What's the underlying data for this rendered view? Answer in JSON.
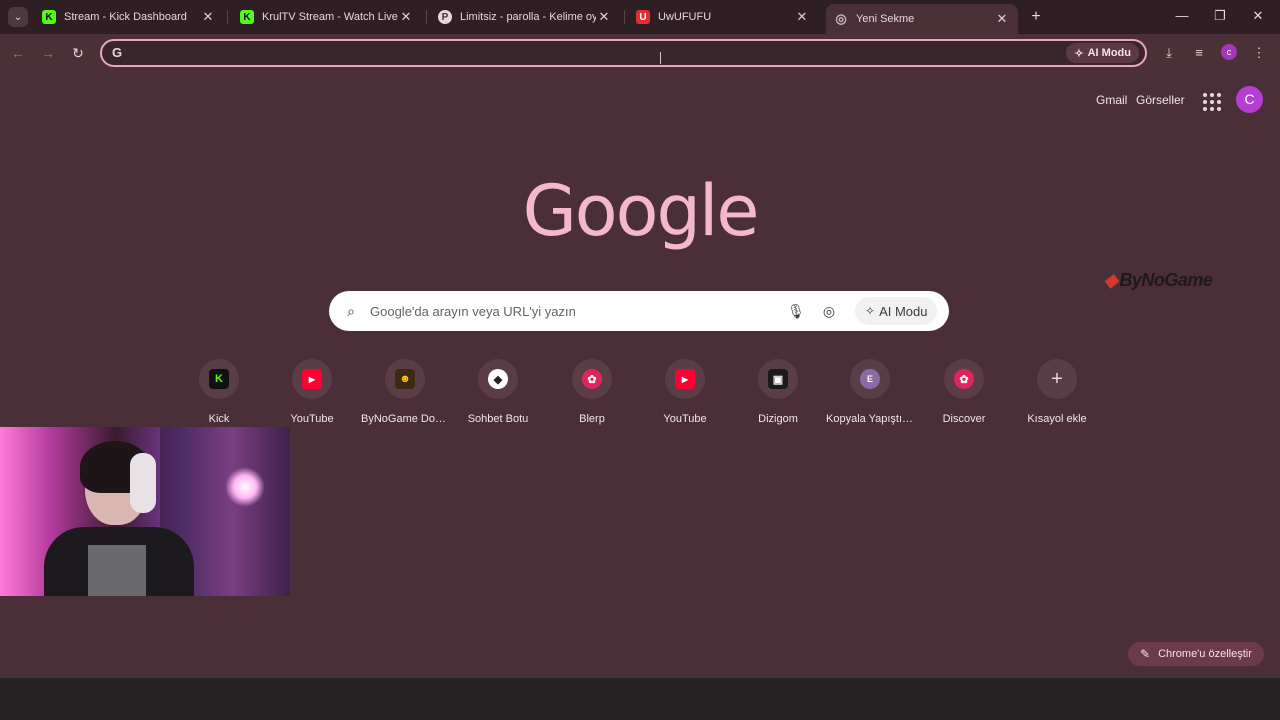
{
  "tabs": [
    {
      "title": "Stream - Kick Dashboard",
      "favicon": "kick-icon",
      "fav_text": "K",
      "fav_color": "#53fc18",
      "active": false
    },
    {
      "title": "KrulTV Stream - Watch Live on Kick",
      "favicon": "kick-icon",
      "fav_text": "K",
      "fav_color": "#53fc18",
      "active": false
    },
    {
      "title": "Limitsiz - parolla - Kelime oyunu",
      "favicon": "parolla-icon",
      "fav_text": "P",
      "fav_color": "#e7d7dd",
      "active": false
    },
    {
      "title": "UwUFUFU",
      "favicon": "uwufufu-icon",
      "fav_text": "U",
      "fav_color": "#e02d36",
      "active": false
    },
    {
      "title": "Yeni Sekme",
      "favicon": "chrome-icon",
      "fav_text": "◎",
      "fav_color": "#c9bcc1",
      "active": true
    }
  ],
  "omnibox": {
    "value": "",
    "ai_label": "AI Modu"
  },
  "header": {
    "gmail": "Gmail",
    "images": "Görseller",
    "avatar_letter": "C",
    "toolbar_avatar_letter": "c"
  },
  "logo": "Google",
  "bynogame_logo": "ByNoGame",
  "search": {
    "placeholder": "Google'da arayın veya URL'yi yazın",
    "ai_label": "AI Modu"
  },
  "shortcuts": [
    {
      "label": "Kick",
      "icon": "kick-icon",
      "glyph": "K",
      "bg": "#111",
      "fg": "#53fc18"
    },
    {
      "label": "YouTube",
      "icon": "youtube-icon",
      "glyph": "▶",
      "bg": "#ff0033",
      "fg": "#fff"
    },
    {
      "label": "ByNoGame Don...",
      "icon": "bynogame-icon",
      "glyph": "☻",
      "bg": "#3a2a10",
      "fg": "#f4c20d"
    },
    {
      "label": "Sohbet Botu",
      "icon": "chatbot-icon",
      "glyph": "◆",
      "bg": "#ffffff",
      "fg": "#222"
    },
    {
      "label": "Blerp",
      "icon": "blerp-icon",
      "glyph": "✿",
      "bg": "#e0245e",
      "fg": "#fff"
    },
    {
      "label": "YouTube",
      "icon": "youtube-icon",
      "glyph": "▶",
      "bg": "#ff0033",
      "fg": "#fff"
    },
    {
      "label": "Dizigom",
      "icon": "dizigom-icon",
      "glyph": "▣",
      "bg": "#1a1a1a",
      "fg": "#fff"
    },
    {
      "label": "Kopyala Yapıştır...",
      "icon": "letter-e-icon",
      "glyph": "E",
      "bg": "#8a6aa0",
      "fg": "#fff"
    },
    {
      "label": "Discover",
      "icon": "blerp-icon",
      "glyph": "✿",
      "bg": "#e0245e",
      "fg": "#fff"
    },
    {
      "label": "Kısayol ekle",
      "icon": "add-icon",
      "glyph": "+",
      "bg": "transparent",
      "fg": "#e7d7dd"
    }
  ],
  "customize_label": "Chrome'u özelleştir",
  "colors": {
    "page_bg": "#4a2f38",
    "toolbar_bg": "#4c3038",
    "logo_pink": "#f4b8cc",
    "accent": "#e7a8be"
  }
}
